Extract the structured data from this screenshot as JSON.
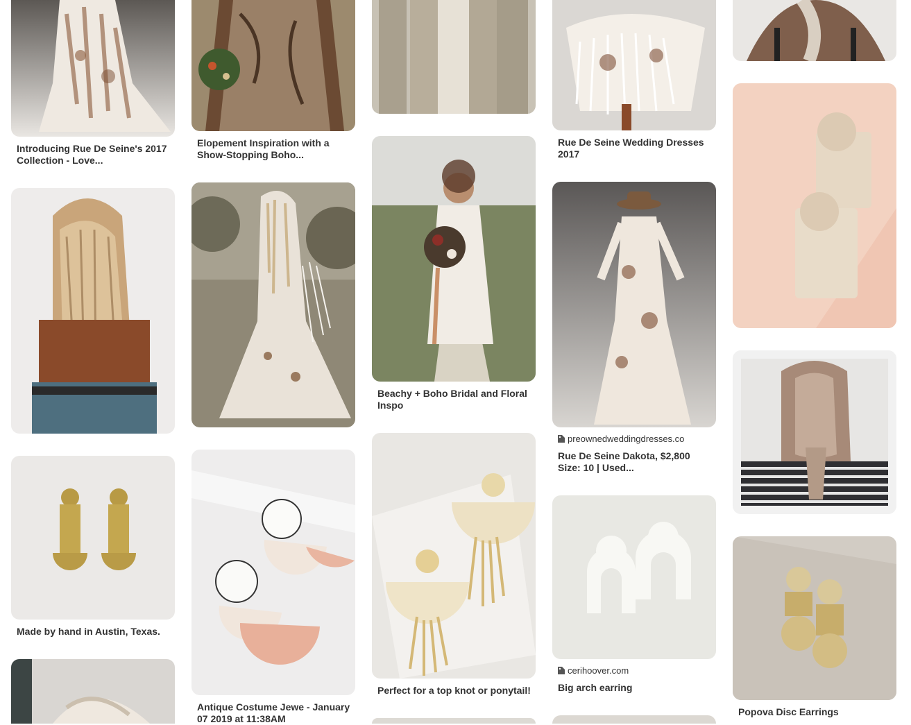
{
  "colors": {
    "background": "#ffffff",
    "title_text": "#333333"
  },
  "pins": [
    {
      "id": "c1p1",
      "title": "Introducing Rue De Seine's 2017 Collection - Love...",
      "image_desc": "white and brown lace bridal gown with train",
      "icon": "image"
    },
    {
      "id": "c1p2",
      "title": "",
      "image_desc": "long wavy braided blonde hair, back view",
      "icon": "image"
    },
    {
      "id": "c1p3",
      "title": "Made by hand in Austin, Texas.",
      "image_desc": "gold brass geometric drop earrings",
      "icon": "image"
    },
    {
      "id": "c1p4",
      "title": "",
      "image_desc": "blonde braided hair",
      "icon": "image"
    },
    {
      "id": "c2p1",
      "title": "Elopement Inspiration with a Show-Stopping Boho...",
      "image_desc": "bride with bouquet in lace gown",
      "icon": "image"
    },
    {
      "id": "c2p2",
      "title": "",
      "image_desc": "bride in fringe lace gown in field",
      "icon": "image"
    },
    {
      "id": "c2p3",
      "title": "Antique Costume Jewe - January 07 2019 at 11:38AM",
      "image_desc": "white and pink half moon earrings",
      "icon": "image"
    },
    {
      "id": "c3p1",
      "title": "",
      "image_desc": "bridesmaids in neutral dresses",
      "icon": "image"
    },
    {
      "id": "c3p2",
      "title": "Beachy + Boho Bridal and Floral Inspo",
      "image_desc": "bride with flower crown and bouquet",
      "icon": "image"
    },
    {
      "id": "c3p3",
      "title": "Perfect for a top knot or ponytail!",
      "image_desc": "gold half moon fringe earrings",
      "icon": "image"
    },
    {
      "id": "c4p1",
      "title": "Rue De Seine Wedding Dresses 2017",
      "image_desc": "fringe wedding dress twirling",
      "icon": "image"
    },
    {
      "id": "c4p2",
      "title": "Rue De Seine Dakota, $2,800 Size: 10 | Used...",
      "source": "preownedweddingdresses.co",
      "image_desc": "bride in hat and fringe gown",
      "icon": "image"
    },
    {
      "id": "c4p3",
      "title": "Big arch earring",
      "source": "cerihoover.com",
      "image_desc": "white clay arch earrings",
      "icon": "image"
    },
    {
      "id": "c5p1",
      "title": "",
      "image_desc": "braided hair back view",
      "icon": "image"
    },
    {
      "id": "c5p2",
      "title": "",
      "image_desc": "gold disc earrings on pink",
      "icon": "image"
    },
    {
      "id": "c5p3",
      "title": "",
      "image_desc": "twisted half up ponytail hairstyle",
      "icon": "image"
    },
    {
      "id": "c5p4",
      "title": "Popova Disc Earrings",
      "image_desc": "gold disc earrings on linen",
      "icon": "image"
    }
  ]
}
